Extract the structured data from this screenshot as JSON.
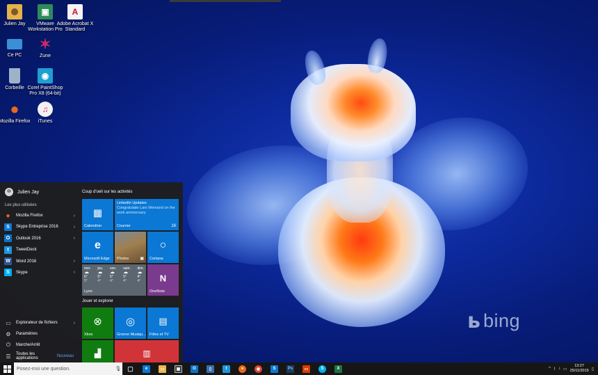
{
  "desktop": {
    "icons": [
      {
        "label": "Julien Jay",
        "icon": "user-folder-icon",
        "glyph": "",
        "color": "#e6b24a"
      },
      {
        "label": "VMware Workstation Pro",
        "icon": "vmware-icon",
        "glyph": "▣",
        "color": "#2d8c5a"
      },
      {
        "label": "Adobe Acrobat X Standard",
        "icon": "acrobat-icon",
        "glyph": "A",
        "color": "#f4f4f4"
      },
      {
        "label": "Ce PC",
        "icon": "computer-icon",
        "glyph": "",
        "color": "#3b8fd6"
      },
      {
        "label": "Zune",
        "icon": "zune-icon",
        "glyph": "✶",
        "color": "#d02b6a"
      },
      {
        "label": "Corbeille",
        "icon": "recycle-bin-icon",
        "glyph": "",
        "color": "#9fb3c8"
      },
      {
        "label": "Corel PaintShop Pro X8 (64-bit)",
        "icon": "paintshop-icon",
        "glyph": "◉",
        "color": "#1f9fd0"
      },
      {
        "label": "Mozilla Firefox",
        "icon": "firefox-icon",
        "glyph": "●",
        "color": "#e8681d"
      },
      {
        "label": "iTunes",
        "icon": "itunes-icon",
        "glyph": "♫",
        "color": "#f2f2f2"
      }
    ]
  },
  "wallpaper": {
    "brand": "bing",
    "brand_glyph": "ь"
  },
  "start_menu": {
    "user_name": "Julien Jay",
    "most_used_label": "Les plus utilisées",
    "apps": [
      {
        "label": "Mozilla Firefox",
        "icon": "firefox-icon",
        "glyph": "●",
        "color": "#e8681d",
        "chevron": "›"
      },
      {
        "label": "Skype Entreprise 2016",
        "icon": "skype-business-icon",
        "glyph": "S",
        "color": "#0a78d4",
        "chevron": "›"
      },
      {
        "label": "Outlook 2016",
        "icon": "outlook-icon",
        "glyph": "O",
        "color": "#0b72c4",
        "chevron": "›"
      },
      {
        "label": "TweetDeck",
        "icon": "tweetdeck-icon",
        "glyph": "t",
        "color": "#1c94e0",
        "chevron": ""
      },
      {
        "label": "Word 2016",
        "icon": "word-icon",
        "glyph": "W",
        "color": "#2b5797",
        "chevron": "›"
      },
      {
        "label": "Skype",
        "icon": "skype-icon",
        "glyph": "S",
        "color": "#00aff0",
        "chevron": "›"
      }
    ],
    "system": [
      {
        "label": "Explorateur de fichiers",
        "icon": "file-explorer-icon",
        "glyph": "▭",
        "chevron": "›"
      },
      {
        "label": "Paramètres",
        "icon": "settings-icon",
        "glyph": "⚙",
        "chevron": ""
      },
      {
        "label": "Marche/Arrêt",
        "icon": "power-icon",
        "glyph": "⏻",
        "chevron": ""
      },
      {
        "label": "Toutes les applications",
        "icon": "all-apps-icon",
        "glyph": "☰",
        "chevron": "",
        "badge": "Nouveau"
      }
    ],
    "group1_title": "Coup d'oeil sur les activités",
    "group2_title": "Jouer et explorer",
    "tiles": {
      "calendar": {
        "label": "Calendrier",
        "glyph": "▦",
        "color": "#0a78d4"
      },
      "mail": {
        "label": "Courrier",
        "count": "16",
        "header": "LinkedIn Updates",
        "body": "Congratulate Lars Weinand on the work anniversary",
        "color": "#0a78d4"
      },
      "edge": {
        "label": "Microsoft Edge",
        "glyph": "e",
        "color": "#0a78d4"
      },
      "photos": {
        "label": "Photos",
        "glyph": "▣"
      },
      "cortana": {
        "label": "Cortana",
        "glyph": "○",
        "color": "#0a78d4"
      },
      "weather": {
        "label": "Lyon",
        "days": [
          {
            "day": "mer.",
            "hi": "6°",
            "lo": "5°"
          },
          {
            "day": "jeu.",
            "hi": "5°",
            "lo": "4°"
          },
          {
            "day": "ven.",
            "hi": "5°",
            "lo": "4°"
          },
          {
            "day": "sam.",
            "hi": "5°",
            "lo": "4°"
          },
          {
            "day": "dim.",
            "hi": "4°",
            "lo": "4°"
          }
        ]
      },
      "onenote": {
        "label": "OneNote",
        "glyph": "N",
        "color": "#7a3a8e"
      },
      "xbox": {
        "label": "Xbox",
        "glyph": "⊗",
        "color": "#107c10"
      },
      "groove": {
        "label": "Groove Musiqu...",
        "glyph": "◎",
        "color": "#0a78d4"
      },
      "films": {
        "label": "Films et TV",
        "glyph": "▤",
        "color": "#0a78d4"
      },
      "money": {
        "glyph": "▟",
        "color": "#107c10"
      },
      "news": {
        "glyph": "▥",
        "color": "#d13438"
      }
    }
  },
  "taskbar": {
    "search_placeholder": "Posez-moi une question.",
    "pinned": [
      {
        "icon": "task-view-icon",
        "glyph": "▢",
        "color": "transparent"
      },
      {
        "icon": "edge-icon",
        "glyph": "e",
        "color": "#0a78d4"
      },
      {
        "icon": "file-explorer-icon",
        "glyph": "▭",
        "color": "#e8b84a"
      },
      {
        "icon": "store-icon",
        "glyph": "▣",
        "color": "#3a3a3a"
      },
      {
        "icon": "outlook-icon",
        "glyph": "O",
        "color": "#0b72c4"
      },
      {
        "icon": "files-icon",
        "glyph": "▯",
        "color": "#3a6fb0"
      },
      {
        "icon": "tweetdeck-icon",
        "glyph": "t",
        "color": "#1c94e0"
      },
      {
        "icon": "firefox-icon",
        "glyph": "●",
        "color": "#e8681d"
      },
      {
        "icon": "chrome-icon",
        "glyph": "◉",
        "color": "#db4437"
      },
      {
        "icon": "skype-business-icon",
        "glyph": "S",
        "color": "#0a78d4"
      },
      {
        "icon": "photoshop-icon",
        "glyph": "Ps",
        "color": "#1e3a5a"
      },
      {
        "icon": "app-red-icon",
        "glyph": "▭",
        "color": "#d83b01"
      },
      {
        "icon": "skype-icon",
        "glyph": "S",
        "color": "#00aff0"
      },
      {
        "icon": "excel-icon",
        "glyph": "X",
        "color": "#1e7145"
      }
    ],
    "tray_icons": [
      "chevron-up-icon",
      "network-icon",
      "volume-icon",
      "battery-icon",
      "action-center-icon"
    ],
    "tray_glyphs": [
      "^",
      "⌇",
      "♪",
      "▭",
      "▯"
    ],
    "time": "13:27",
    "date": "25/11/2015"
  }
}
